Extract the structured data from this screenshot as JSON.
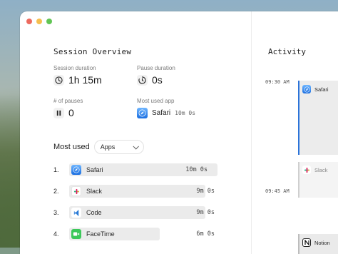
{
  "overview": {
    "title": "Session Overview",
    "session_duration_label": "Session duration",
    "session_duration_value": "1h 15m",
    "pause_duration_label": "Pause duration",
    "pause_duration_value": "0s",
    "pauses_label": "# of pauses",
    "pauses_value": "0",
    "most_used_app_label": "Most used app",
    "most_used_app_name": "Safari",
    "most_used_app_time": "10m 0s"
  },
  "most_used": {
    "label": "Most used",
    "filter_value": "Apps",
    "items": [
      {
        "rank": "1.",
        "name": "Safari",
        "duration": "10m 0s",
        "share": 1.0,
        "icon": "safari-icon"
      },
      {
        "rank": "2.",
        "name": "Slack",
        "duration": "9m 0s",
        "share": 0.9,
        "icon": "slack-icon"
      },
      {
        "rank": "3.",
        "name": "Code",
        "duration": "9m 0s",
        "share": 0.9,
        "icon": "vscode-icon"
      },
      {
        "rank": "4.",
        "name": "FaceTime",
        "duration": "6m 0s",
        "share": 0.6,
        "icon": "facetime-icon"
      }
    ]
  },
  "activity": {
    "title": "Activity",
    "entries": [
      {
        "time": "09:30 AM",
        "app": "Safari"
      },
      {
        "time": "",
        "app": "Slack"
      },
      {
        "time": "09:45 AM",
        "app": ""
      },
      {
        "time": "",
        "app": "Notion"
      }
    ]
  },
  "colors": {
    "bar": "#ebebeb",
    "accent_blue": "#2b73d9"
  }
}
